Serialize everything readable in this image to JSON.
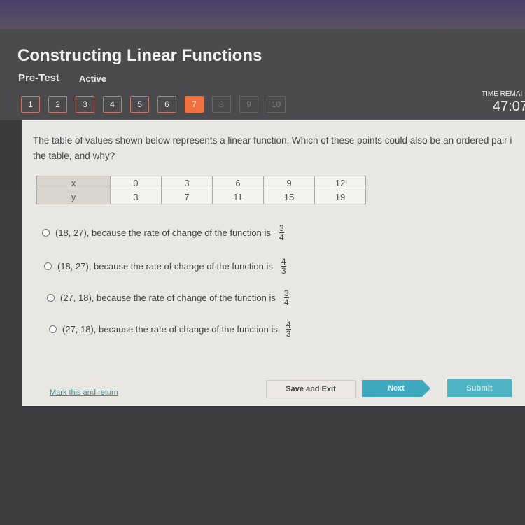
{
  "header": {
    "title": "Constructing Linear Functions",
    "mode": "Pre-Test",
    "status": "Active",
    "time_label": "TIME REMAI",
    "time": "47:07"
  },
  "questions": [
    "1",
    "2",
    "3",
    "4",
    "5",
    "6",
    "7",
    "8",
    "9",
    "10"
  ],
  "current_question": 7,
  "question": {
    "text": "The table of values shown below represents a linear function. Which of these points could also be an ordered pair i the table, and why?"
  },
  "table": {
    "x_label": "x",
    "y_label": "y",
    "x": [
      "0",
      "3",
      "6",
      "9",
      "12"
    ],
    "y": [
      "3",
      "7",
      "11",
      "15",
      "19"
    ]
  },
  "options": [
    {
      "text": "(18, 27), because the rate of change of the function is",
      "num": "3",
      "den": "4"
    },
    {
      "text": "(18, 27), because the rate of change of the function is",
      "num": "4",
      "den": "3"
    },
    {
      "text": "(27, 18), because the rate of change of the function is",
      "num": "3",
      "den": "4"
    },
    {
      "text": "(27, 18), because the rate of change of the function is",
      "num": "4",
      "den": "3"
    }
  ],
  "footer": {
    "mark": "Mark this and return",
    "save": "Save and Exit",
    "next": "Next",
    "submit": "Submit"
  },
  "colors": {
    "accent": "#f07040",
    "button": "#3fa9bf"
  }
}
